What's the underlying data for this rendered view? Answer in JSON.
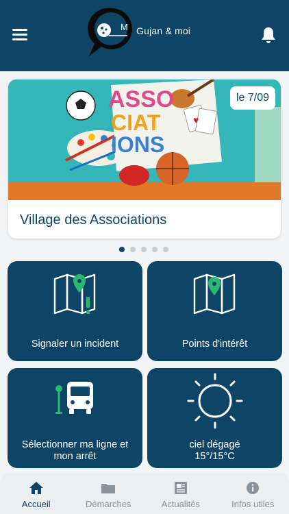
{
  "header": {
    "brand": "Gujan & moi",
    "logo_letter": "M"
  },
  "event_card": {
    "date": "le 7/09",
    "title": "Village des Associations",
    "banner_text": [
      "ASSO",
      "CIAT",
      "IONS"
    ]
  },
  "carousel": {
    "count": 5,
    "active": 1
  },
  "tiles": [
    {
      "label": "Signaler un incident"
    },
    {
      "label": "Points d'intérêt"
    },
    {
      "label": "Sélectionner ma ligne et mon arrêt"
    },
    {
      "label": "ciel dégagé 15°/15°C"
    }
  ],
  "nav": [
    {
      "label": "Accueil",
      "icon": "home-icon",
      "active": true
    },
    {
      "label": "Démarches",
      "icon": "folder-icon"
    },
    {
      "label": "Actualités",
      "icon": "newspaper-icon"
    },
    {
      "label": "Infos utiles",
      "icon": "info-icon"
    }
  ],
  "colors": {
    "primary": "#0e4466",
    "accent_green": "#2db872",
    "banner_bg": "#35b6b9"
  }
}
